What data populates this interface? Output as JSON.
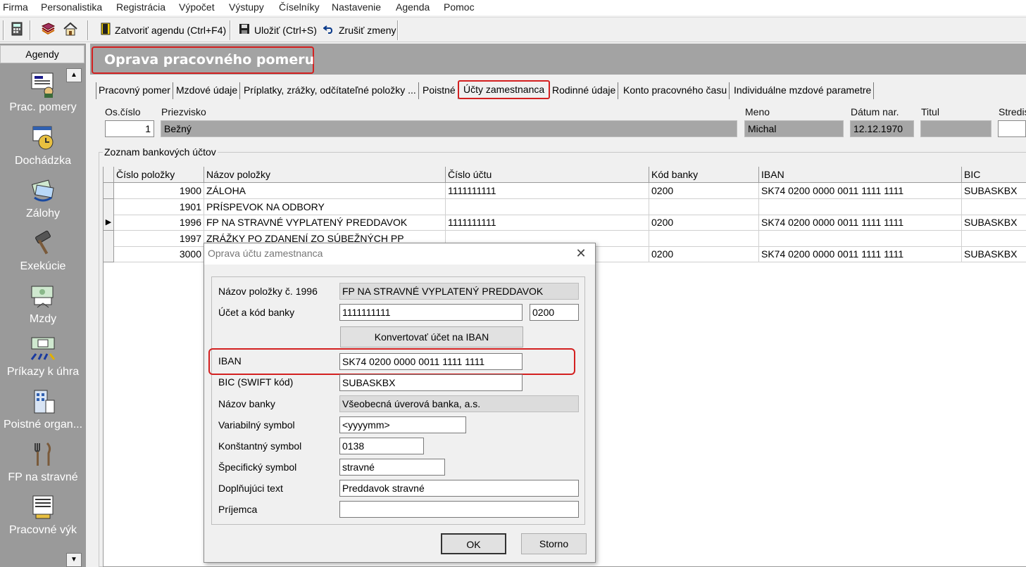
{
  "menu": [
    "Firma",
    "Personalistika",
    "Registrácia",
    "Výpočet",
    "Výstupy",
    "Číselníky",
    "Nastavenie",
    "Agenda",
    "Pomoc"
  ],
  "toolbar": {
    "close_label": "Zatvoriť agendu (Ctrl+F4)",
    "save_label": "Uložiť (Ctrl+S)",
    "cancel_label": "Zrušiť zmeny"
  },
  "sidebar": {
    "header": "Agendy",
    "items": [
      {
        "label": "Prac. pomery",
        "icon": "employment-icon"
      },
      {
        "label": "Dochádzka",
        "icon": "attendance-icon"
      },
      {
        "label": "Zálohy",
        "icon": "advances-icon"
      },
      {
        "label": "Exekúcie",
        "icon": "execution-icon"
      },
      {
        "label": "Mzdy",
        "icon": "wages-icon"
      },
      {
        "label": "Príkazy k úhra",
        "icon": "sepa-icon"
      },
      {
        "label": "Poistné organ...",
        "icon": "insurance-icon"
      },
      {
        "label": "FP na stravné",
        "icon": "meal-icon"
      },
      {
        "label": "Pracovné výk",
        "icon": "work-reports-icon"
      }
    ]
  },
  "page_title": "Oprava pracovného pomeru",
  "tabs": [
    "Pracovný pomer",
    "Mzdové údaje",
    "Príplatky, zrážky, odčítateľné položky ...",
    "Poistné",
    "Účty zamestnanca",
    "Rodinné údaje",
    "Konto pracovného času",
    "Individuálne mzdové parametre"
  ],
  "employee": {
    "labels": {
      "os_cislo": "Os.číslo",
      "priezvisko": "Priezvisko",
      "meno": "Meno",
      "datum": "Dátum nar.",
      "titul": "Titul",
      "stredisko": "Stredis"
    },
    "os_cislo": "1",
    "priezvisko": "Bežný",
    "meno": "Michal",
    "datum": "12.12.1970",
    "titul": ""
  },
  "accounts": {
    "group_label": "Zoznam bankových účtov",
    "columns": [
      "Číslo položky",
      "Názov položky",
      "Číslo účtu",
      "Kód banky",
      "IBAN",
      "BIC"
    ],
    "rows": [
      {
        "cislo": "1900",
        "nazov": "ZÁLOHA",
        "ucet": "1111111111",
        "kod": "0200",
        "iban": "SK74 0200 0000 0011 1111 1111",
        "bic": "SUBASKBX"
      },
      {
        "cislo": "1901",
        "nazov": "PRÍSPEVOK NA ODBORY",
        "ucet": "",
        "kod": "",
        "iban": "",
        "bic": ""
      },
      {
        "cislo": "1996",
        "nazov": "FP NA STRAVNÉ VYPLATENÝ PREDDAVOK",
        "ucet": "1111111111",
        "kod": "0200",
        "iban": "SK74 0200 0000 0011 1111 1111",
        "bic": "SUBASKBX"
      },
      {
        "cislo": "1997",
        "nazov": "ZRÁŽKY PO ZDANENÍ ZO SÚBEŽNÝCH PP",
        "ucet": "",
        "kod": "",
        "iban": "",
        "bic": ""
      },
      {
        "cislo": "3000",
        "nazov": "",
        "ucet": "",
        "kod": "0200",
        "iban": "SK74 0200 0000 0011 1111 1111",
        "bic": "SUBASKBX"
      }
    ]
  },
  "dialog": {
    "title": "Oprava účtu zamestnanca",
    "labels": {
      "nazov_polozky": "Názov položky č. 1996",
      "ucet": "Účet a kód banky",
      "iban": "IBAN",
      "bic": "BIC (SWIFT kód)",
      "nazov_banky": "Názov banky",
      "vs": "Variabilný symbol",
      "ks": "Konštantný symbol",
      "ss": "Špecifický symbol",
      "text": "Doplňujúci text",
      "prijemca": "Príjemca"
    },
    "values": {
      "nazov_polozky": "FP NA STRAVNÉ VYPLATENÝ PREDDAVOK",
      "ucet": "1111111111",
      "kod_banky": "0200",
      "iban": "SK74 0200 0000 0011 1111 1111",
      "bic": "SUBASKBX",
      "nazov_banky": "Všeobecná úverová banka, a.s.",
      "vs": "<yyyymm>",
      "ks": "0138",
      "ss": "stravné",
      "text": "Preddavok stravné",
      "prijemca": ""
    },
    "convert_label": "Konvertovať účet na IBAN",
    "ok_label": "OK",
    "cancel_label": "Storno"
  },
  "colors": {
    "highlight": "#d32020",
    "sidebar": "#9a9a9a",
    "title_band": "#a3a3a3"
  }
}
